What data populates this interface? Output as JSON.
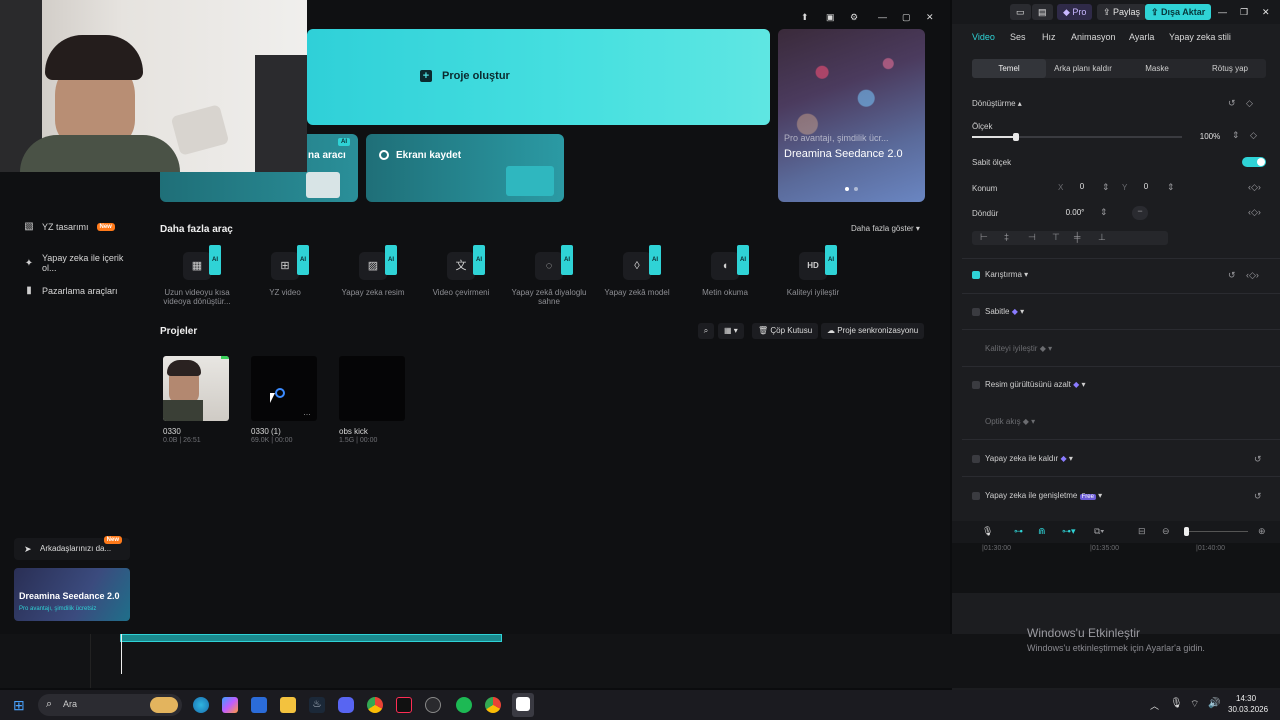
{
  "editor": {
    "topbar": {
      "pro": "Pro",
      "share": "Paylaş",
      "export": "Dışa Aktar"
    },
    "prop_tabs": [
      "Video",
      "Ses",
      "Hız",
      "Animasyon",
      "Ayarla",
      "Yapay zeka stili"
    ],
    "sub_tabs": [
      "Temel",
      "Arka planı kaldır",
      "Maske",
      "Rötuş yap"
    ],
    "transform": {
      "title": "Dönüştürme",
      "scale_label": "Ölçek",
      "scale_value": "100%",
      "uniform_scale": "Sabit ölçek",
      "position_label": "Konum",
      "pos_x_label": "X",
      "pos_x": "0",
      "pos_y_label": "Y",
      "pos_y": "0",
      "rotate_label": "Döndür",
      "rotate_value": "0.00°"
    },
    "blend": "Karıştırma",
    "stabilize": "Sabitle",
    "enhance_quality": "Kaliteyi iyileştir",
    "denoise": "Resim gürültüsünü azalt",
    "optical_flow": "Optik akış",
    "ai_remove": "Yapay zeka ile kaldır",
    "ai_expand": "Yapay zeka ile genişletme",
    "free_badge": "Free",
    "ruler": [
      "|01:30:00",
      "|01:35:00",
      "|01:40:00"
    ]
  },
  "home": {
    "create_project": "Proje oluştur",
    "tool_card_a": "na aracı",
    "tool_card_b": "Ekranı kaydet",
    "ai_badge": "AI",
    "promo": {
      "line1": "Pro avantajı, şimdilik ücr...",
      "line2": "Dreamina Seedance 2.0"
    },
    "sidebar": [
      {
        "label": "YZ tasarımı",
        "badge": "New"
      },
      {
        "label": "Yapay zeka ile içerik ol..."
      },
      {
        "label": "Pazarlama araçları"
      }
    ],
    "invite": {
      "label": "Arkadaşlarınızı da...",
      "badge": "New"
    },
    "sidebar_promo": {
      "title": "Dreamina Seedance 2.0",
      "sub": "Pro avantajı, şimdilik ücretsiz"
    },
    "more_tools_title": "Daha fazla araç",
    "show_more": "Daha fazla göster",
    "tools": [
      {
        "label": "Uzun videoyu kısa videoya dönüştür...",
        "icon": "film-icon"
      },
      {
        "label": "YZ video",
        "icon": "video-plus-icon"
      },
      {
        "label": "Yapay zeka resim",
        "icon": "image-icon"
      },
      {
        "label": "Video çevirmeni",
        "icon": "translate-icon"
      },
      {
        "label": "Yapay zekâ diyaloglu sahne",
        "icon": "dialog-icon"
      },
      {
        "label": "Yapay zekâ model",
        "icon": "shirt-icon"
      },
      {
        "label": "Metin okuma",
        "icon": "speech-icon"
      },
      {
        "label": "Kaliteyi iyileştir",
        "icon": "hd-icon"
      }
    ],
    "projects_title": "Projeler",
    "trash": "Çöp Kutusu",
    "sync": "Proje senkronizasyonu",
    "projects": [
      {
        "name": "0330",
        "meta": "0.0B | 26:51"
      },
      {
        "name": "0330 (1)",
        "meta": "69.0K | 00:00"
      },
      {
        "name": "obs kick",
        "meta": "1.5G | 00:00"
      }
    ]
  },
  "windows": {
    "activate_title": "Windows'u Etkinleştir",
    "activate_sub": "Windows'u etkinleştirmek için Ayarlar'a gidin.",
    "search": "Ara",
    "time": "14:30",
    "date": "30.03.2026"
  },
  "colors": {
    "accent": "#2fd3d6",
    "new_badge": "#ff7a1a"
  }
}
